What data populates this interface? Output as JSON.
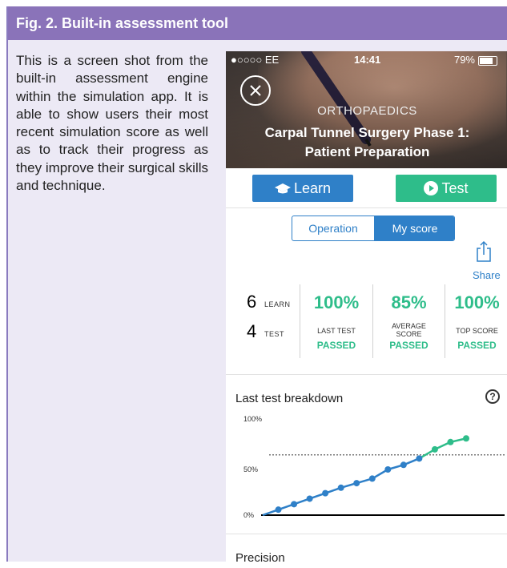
{
  "figure": {
    "title": "Fig. 2. Built-in assessment tool",
    "caption": "This is a screen shot from the built-in assessment engine within the simulation app. It is able to show users their most recent simulation score as well as to track their progress as they improve their surgical skills and technique."
  },
  "status_bar": {
    "carrier": "●○○○○ EE",
    "time": "14:41",
    "battery": "79%"
  },
  "hero": {
    "category": "ORTHOPAEDICS",
    "title_line1": "Carpal Tunnel Surgery Phase 1:",
    "title_line2": "Patient Preparation"
  },
  "actions": {
    "learn_label": "Learn",
    "test_label": "Test"
  },
  "segmented": {
    "operation_label": "Operation",
    "my_score_label": "My score",
    "selected": "My score"
  },
  "share": {
    "label": "Share"
  },
  "stats": {
    "learn_count": "6",
    "learn_label": "LEARN",
    "test_count": "4",
    "test_label": "TEST",
    "last_test": {
      "value": "100%",
      "label": "LAST TEST",
      "status": "PASSED"
    },
    "average": {
      "value": "85%",
      "label_line1": "AVERAGE",
      "label_line2": "SCORE",
      "status": "PASSED"
    },
    "top": {
      "value": "100%",
      "label": "TOP SCORE",
      "status": "PASSED"
    }
  },
  "breakdown": {
    "title": "Last test breakdown",
    "help": "?"
  },
  "next_section": {
    "title": "Precision"
  },
  "colors": {
    "accent_blue": "#2f80c8",
    "accent_green": "#2ebd8a",
    "header_purple": "#8a73b9"
  },
  "chart_data": {
    "type": "line",
    "y_ticks": [
      "100%",
      "50%",
      "0%"
    ],
    "ylim": [
      0,
      100
    ],
    "pass_threshold": 66,
    "x": [
      0,
      1,
      2,
      3,
      4,
      5,
      6,
      7,
      8,
      9,
      10,
      11,
      12,
      13
    ],
    "values": [
      0,
      6,
      12,
      18,
      24,
      30,
      35,
      40,
      50,
      55,
      62,
      72,
      80,
      84
    ],
    "series_colors": {
      "below_threshold": "#2f80c8",
      "above_threshold": "#2ebd8a"
    }
  }
}
